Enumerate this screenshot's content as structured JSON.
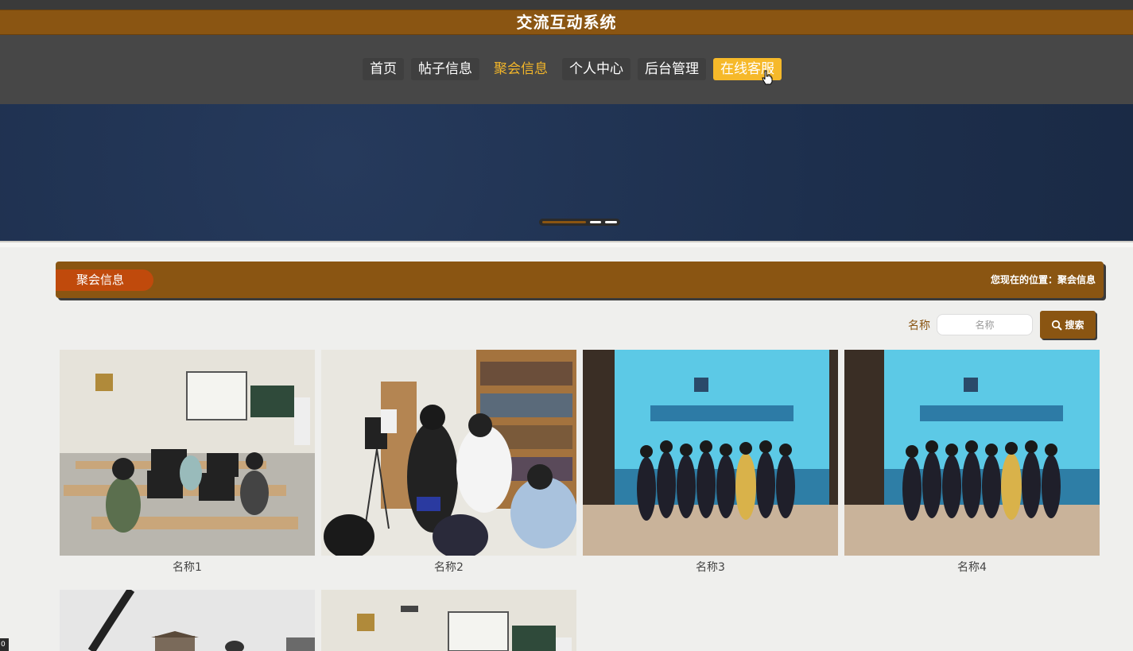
{
  "header": {
    "title": "交流互动系统"
  },
  "nav": {
    "items": [
      {
        "label": "首页"
      },
      {
        "label": "帖子信息"
      },
      {
        "label": "聚会信息"
      },
      {
        "label": "个人中心"
      },
      {
        "label": "后台管理"
      },
      {
        "label": "在线客服"
      }
    ],
    "active_index": 2,
    "highlight_index": 5
  },
  "banner": {
    "slides": 3,
    "current": 1
  },
  "section": {
    "title": "聚会信息",
    "breadcrumb": "您现在的位置：聚会信息"
  },
  "search": {
    "label": "名称",
    "placeholder": "名称",
    "button_label": "搜索"
  },
  "items": [
    {
      "caption": "名称1"
    },
    {
      "caption": "名称2"
    },
    {
      "caption": "名称3"
    },
    {
      "caption": "名称4"
    },
    {
      "caption": ""
    },
    {
      "caption": ""
    }
  ],
  "footer": {
    "corner_badge": "0"
  },
  "colors": {
    "brand": "#8a5512",
    "accent": "#f6b92a",
    "nav_bg": "#474747",
    "pill": "#c04a0c"
  }
}
